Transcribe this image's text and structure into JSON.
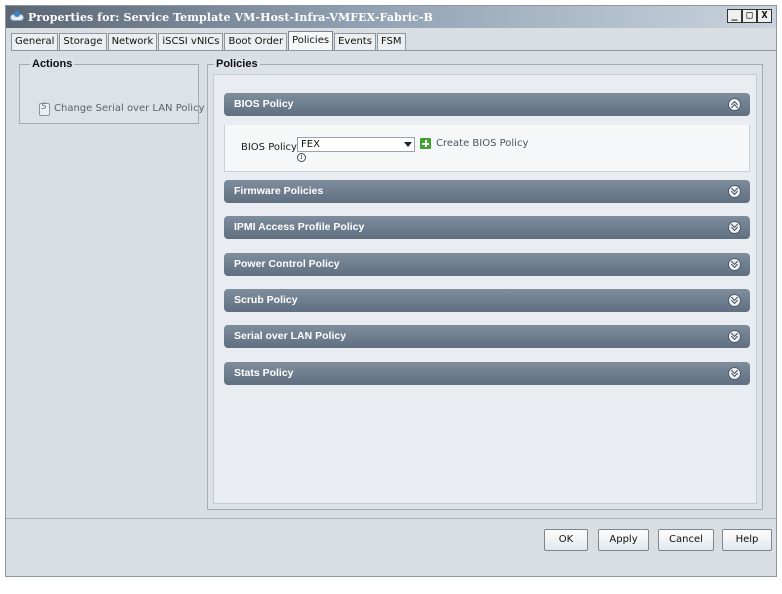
{
  "window": {
    "title": "Properties for: Service Template VM-Host-Infra-VMFEX-Fabric-B",
    "controls": {
      "minimize": "_",
      "maximize": "□",
      "close": "X"
    }
  },
  "tabs": [
    {
      "label": "General"
    },
    {
      "label": "Storage"
    },
    {
      "label": "Network"
    },
    {
      "label": "iSCSI vNICs"
    },
    {
      "label": "Boot Order"
    },
    {
      "label": "Policies",
      "active": true
    },
    {
      "label": "Events"
    },
    {
      "label": "FSM"
    }
  ],
  "actions": {
    "title": "Actions",
    "items": [
      {
        "label": "Change Serial over LAN Policy"
      }
    ]
  },
  "policies": {
    "title": "Policies",
    "sections": [
      {
        "label": "BIOS Policy",
        "state": "expanded"
      },
      {
        "label": "Firmware Policies",
        "state": "collapsed"
      },
      {
        "label": "IPMI Access Profile Policy",
        "state": "collapsed"
      },
      {
        "label": "Power Control Policy",
        "state": "collapsed"
      },
      {
        "label": "Scrub Policy",
        "state": "collapsed"
      },
      {
        "label": "Serial over LAN Policy",
        "state": "collapsed"
      },
      {
        "label": "Stats Policy",
        "state": "collapsed"
      }
    ],
    "bios": {
      "field_label": "BIOS Policy:",
      "selected_value": "FEX",
      "create_link": "Create BIOS Policy"
    }
  },
  "buttons": {
    "ok": "OK",
    "apply": "Apply",
    "cancel": "Cancel",
    "help": "Help"
  },
  "colors": {
    "section_header": "#6b7b8c",
    "panel_bg": "#dde2e7",
    "create_icon": "#3fa22f"
  }
}
